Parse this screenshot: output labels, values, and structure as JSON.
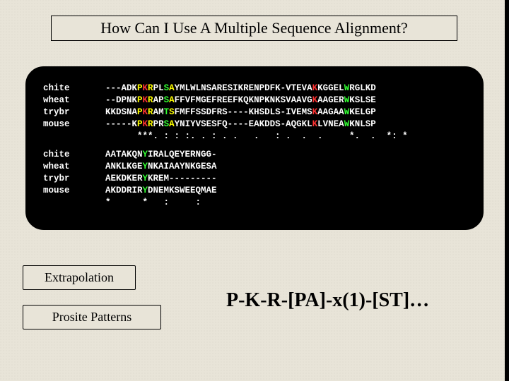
{
  "title": "How Can I Use A Multiple Sequence Alignment?",
  "alignment": {
    "block1": {
      "labels": [
        "chite",
        "wheat",
        "trybr",
        "mouse"
      ],
      "seqs": [
        [
          [
            "w",
            "---ADK"
          ],
          [
            "y",
            "P"
          ],
          [
            "r",
            "K"
          ],
          [
            "y",
            "R"
          ],
          [
            "w",
            "PL"
          ],
          [
            "g",
            "S"
          ],
          [
            "y",
            "A"
          ],
          [
            "w",
            "YMLWLNSARESIKRENPDFK-VTEVA"
          ],
          [
            "r",
            "K"
          ],
          [
            "w",
            "KGGEL"
          ],
          [
            "g",
            "W"
          ],
          [
            "w",
            "RGLKD"
          ]
        ],
        [
          [
            "w",
            "--DPNK"
          ],
          [
            "y",
            "P"
          ],
          [
            "r",
            "K"
          ],
          [
            "y",
            "R"
          ],
          [
            "w",
            "AP"
          ],
          [
            "g",
            "S"
          ],
          [
            "y",
            "A"
          ],
          [
            "w",
            "FFVFMGEFREEFKQKNPKNKSVAAVG"
          ],
          [
            "r",
            "K"
          ],
          [
            "w",
            "AAGER"
          ],
          [
            "g",
            "W"
          ],
          [
            "w",
            "KSLSE"
          ]
        ],
        [
          [
            "w",
            "KKDSNA"
          ],
          [
            "y",
            "P"
          ],
          [
            "r",
            "K"
          ],
          [
            "y",
            "R"
          ],
          [
            "w",
            "AM"
          ],
          [
            "g",
            "T"
          ],
          [
            "y",
            "S"
          ],
          [
            "w",
            "FMFFSSDFRS----KHSDLS-IVEMS"
          ],
          [
            "r",
            "K"
          ],
          [
            "w",
            "AAGAA"
          ],
          [
            "g",
            "W"
          ],
          [
            "w",
            "KELGP"
          ]
        ],
        [
          [
            "w",
            "-----K"
          ],
          [
            "y",
            "P"
          ],
          [
            "r",
            "K"
          ],
          [
            "y",
            "R"
          ],
          [
            "w",
            "PR"
          ],
          [
            "g",
            "S"
          ],
          [
            "y",
            "A"
          ],
          [
            "w",
            "YNIYVSESFQ----EAKDDS-AQGKL"
          ],
          [
            "r",
            "K"
          ],
          [
            "w",
            "LVNEA"
          ],
          [
            "g",
            "W"
          ],
          [
            "w",
            "KNLSP"
          ]
        ]
      ],
      "consensus": "      ***. : : :. . : . .   .   : .  .  .     *.  .  *: *"
    },
    "block2": {
      "labels": [
        "chite",
        "wheat",
        "trybr",
        "mouse"
      ],
      "seqs": [
        [
          [
            "w",
            "AATAKQN"
          ],
          [
            "g",
            "Y"
          ],
          [
            "w",
            "IRALQEYERNGG-"
          ]
        ],
        [
          [
            "w",
            "ANKLKGE"
          ],
          [
            "g",
            "Y"
          ],
          [
            "w",
            "NKAIAAYNKGESA"
          ]
        ],
        [
          [
            "w",
            "AEKDKER"
          ],
          [
            "g",
            "Y"
          ],
          [
            "w",
            "KREM---------"
          ]
        ],
        [
          [
            "w",
            "AKDDRIR"
          ],
          [
            "g",
            "Y"
          ],
          [
            "w",
            "DNEMKSWEEQMAE"
          ]
        ]
      ],
      "consensus": "*      *   :     :  "
    }
  },
  "tags": {
    "extrapolation": "Extrapolation",
    "prosite": "Prosite Patterns"
  },
  "pattern": "P-K-R-[PA]-x(1)-[ST]…"
}
